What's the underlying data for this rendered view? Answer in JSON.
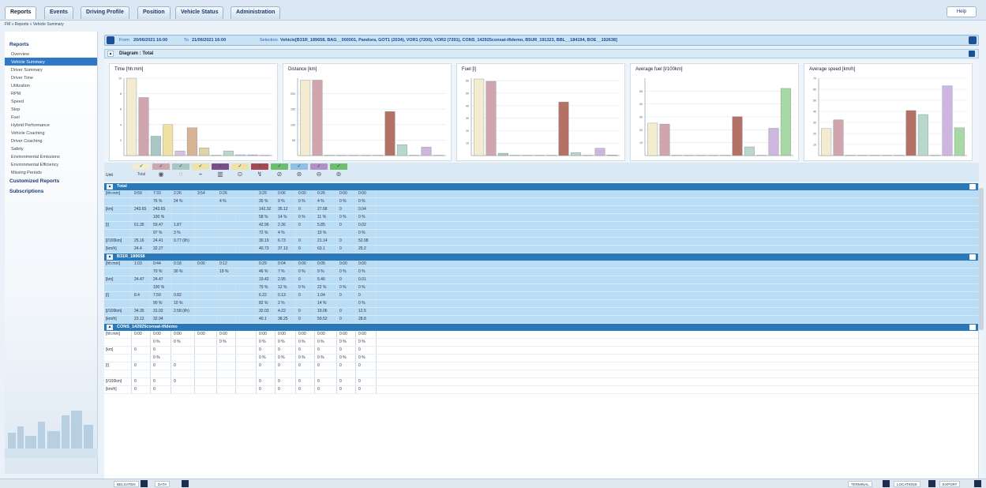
{
  "nav": {
    "tabs": [
      "Reports",
      "Events",
      "Driving Profile",
      "Position",
      "Vehicle Status",
      "Administration"
    ],
    "active_tab": "Reports",
    "help": "Help"
  },
  "breadcrumb": "FM  »  Reports  »  Vehicle Summary",
  "sidebar": {
    "header": "Reports",
    "items": [
      "Overview",
      "Vehicle Summary",
      "Driver Summary",
      "Driver Time",
      "Utilization",
      "RPM",
      "Speed",
      "Stop",
      "Fuel",
      "Hybrid Performance",
      "Vehicle Coaching",
      "Driver Coaching",
      "Safety",
      "Environmental Emissions",
      "Environmental Efficiency",
      "Missing Periods"
    ],
    "selected": "Vehicle Summary",
    "sections": [
      "Customized Reports",
      "Subscriptions"
    ]
  },
  "filter": {
    "from_label": "From",
    "from": "20/06/2021 16:00",
    "to_label": "To",
    "to": "21/06/2021 16:00",
    "selection_label": "Selection",
    "selection": "Vehicle[B31R_189658, BAG__000001, Pandora, GOT1 (2034), VOR1 (7200), VOR2 (7201), CONS_142925consat-tfidemo, B5UR_191323, BBL__184194, BOE__192638]"
  },
  "diagram_title": "Diagram : Total",
  "colors": {
    "bar_series": [
      "#f3ecd0",
      "#cfa6ad",
      "#a9c6c3",
      "#efe2a4",
      "#d7c1dc",
      "#d8b295",
      "#e0d2a9",
      "#b47267",
      "#b7d8cb",
      "#b6d5ed",
      "#cdb7de",
      "#a8d8a5"
    ],
    "section_blue": "#2a78b8",
    "selected": "#2e78c8"
  },
  "chart_data": [
    {
      "type": "bar",
      "title": "Time [hh:mm]",
      "ylim": [
        0,
        10
      ],
      "yticks": [
        "2",
        "4",
        "6",
        "8",
        "10"
      ],
      "values": [
        10,
        7.5,
        2.5,
        4,
        0.6,
        3.6,
        1,
        0,
        0.6,
        0.1,
        0.1,
        0
      ]
    },
    {
      "type": "bar",
      "title": "Distance [km]",
      "ylim": [
        0,
        250
      ],
      "yticks": [
        "50",
        "100",
        "150",
        "200"
      ],
      "values": [
        243.65,
        243.65,
        0,
        0,
        0,
        0,
        0,
        142.32,
        35.12,
        0,
        27.68,
        0
      ]
    },
    {
      "type": "bar",
      "title": "Fuel [l]",
      "ylim": [
        0,
        62
      ],
      "yticks": [
        "10",
        "20",
        "30",
        "40",
        "50",
        "60"
      ],
      "values": [
        61.35,
        59.47,
        1.87,
        0,
        0,
        0,
        0,
        42.96,
        2.36,
        0,
        5.85,
        0.02
      ]
    },
    {
      "type": "bar",
      "title": "Average fuel [l/100km]",
      "ylim": [
        0,
        60
      ],
      "yticks": [
        "10",
        "20",
        "30",
        "40",
        "50"
      ],
      "values": [
        25.16,
        24.41,
        0,
        0,
        0,
        0,
        0,
        30.19,
        6.73,
        0,
        21.14,
        52.08
      ]
    },
    {
      "type": "bar",
      "title": "Average speed [km/h]",
      "ylim": [
        0,
        70
      ],
      "yticks": [
        "10",
        "20",
        "30",
        "40",
        "50",
        "60",
        "70"
      ],
      "values": [
        24.4,
        32.27,
        0,
        0,
        0,
        0,
        0,
        40.73,
        37.13,
        0,
        63.1,
        25.2
      ]
    }
  ],
  "icon_row": {
    "unit": "Unit",
    "total": "Total",
    "checks": [
      "✓",
      "✓",
      "✓",
      "✓",
      "✓",
      "✓",
      "✓",
      "✓",
      "✓",
      "✓",
      "✓",
      "✓"
    ],
    "icons": [
      "fuel-wheel-icon",
      "engine-icon",
      "idle-icon",
      "pto-icon",
      "coasting-icon",
      "brake-icon",
      "gauge-icon",
      "overspeed-icon",
      "stop-icon",
      "cruise-icon"
    ]
  },
  "sections": [
    {
      "title": "Total",
      "blue": true,
      "rows": [
        [
          "[hh:mm]",
          "9:59",
          "7:33",
          "2:26",
          "3:54",
          "0:26",
          "3:29",
          "0:06",
          "0:00",
          "0:26",
          "0:00",
          "0:00"
        ],
        [
          "",
          "",
          "76 %",
          "24 %",
          "",
          "4 %",
          "35 %",
          "9 %",
          "0 %",
          "4 %",
          "0 %",
          "0 %"
        ],
        [
          "[km]",
          "243.65",
          "243.65",
          "",
          "",
          "",
          "142.32",
          "35.12",
          "0",
          "27.68",
          "0",
          "0.04"
        ],
        [
          "",
          "",
          "100 %",
          "",
          "",
          "",
          "58 %",
          "14 %",
          "0 %",
          "11 %",
          "0 %",
          "0 %"
        ],
        [
          "[l]",
          "61.35",
          "59.47",
          "1.87",
          "",
          "",
          "42.96",
          "2.36",
          "0",
          "5.85",
          "0",
          "0.02"
        ],
        [
          "",
          "",
          "97 %",
          "3 %",
          "",
          "",
          "72 %",
          "4 %",
          "",
          "10 %",
          "",
          "0 %"
        ],
        [
          "[l/100km]",
          "25.16",
          "24.41",
          "0.77 (l/h)",
          "",
          "",
          "30.19",
          "6.73",
          "0",
          "21.14",
          "0",
          "52.08"
        ],
        [
          "[km/h]",
          "24.4",
          "32.27",
          "",
          "",
          "",
          "40.73",
          "37.13",
          "0",
          "63.1",
          "0",
          "25.2"
        ]
      ]
    },
    {
      "title": "B31R_189658",
      "blue": true,
      "rows": [
        [
          "[hh:mm]",
          "1:03",
          "0:44",
          "0:18",
          "0:00",
          "0:12",
          "0:29",
          "0:04",
          "0:00",
          "0:05",
          "0:00",
          "0:00"
        ],
        [
          "",
          "",
          "70 %",
          "30 %",
          "",
          "19 %",
          "46 %",
          "7 %",
          "0 %",
          "9 %",
          "0 %",
          "0 %"
        ],
        [
          "[km]",
          "24.47",
          "24.47",
          "",
          "",
          "",
          "19.42",
          "2.95",
          "0",
          "5.46",
          "0",
          "0.01"
        ],
        [
          "",
          "",
          "100 %",
          "",
          "",
          "",
          "79 %",
          "12 %",
          "0 %",
          "22 %",
          "0 %",
          "0 %"
        ],
        [
          "[l]",
          "8.4",
          "7.59",
          "0.82",
          "",
          "",
          "6.22",
          "0.13",
          "0",
          "1.04",
          "0",
          "0"
        ],
        [
          "",
          "",
          "90 %",
          "10 %",
          "",
          "",
          "82 %",
          "2 %",
          "",
          "14 %",
          "",
          "0 %"
        ],
        [
          "[l/100km]",
          "34.35",
          "31.02",
          "2.58 (l/h)",
          "",
          "",
          "32.03",
          "4.22",
          "0",
          "19.06",
          "0",
          "12.5"
        ],
        [
          "[km/h]",
          "23.12",
          "32.94",
          "",
          "",
          "",
          "40.1",
          "38.25",
          "0",
          "59.52",
          "0",
          "28.8"
        ]
      ]
    },
    {
      "title": "CONS_142925consat-tfidemo",
      "blue": false,
      "rows": [
        [
          "[hh:mm]",
          "0:00",
          "0:00",
          "0:00",
          "0:00",
          "0:00",
          "0:00",
          "0:00",
          "0:00",
          "0:00",
          "0:00",
          "0:00"
        ],
        [
          "",
          "",
          "0 %",
          "0 %",
          "",
          "0 %",
          "0 %",
          "0 %",
          "0 %",
          "0 %",
          "0 %",
          "0 %"
        ],
        [
          "[km]",
          "0",
          "0",
          "",
          "",
          "",
          "0",
          "0",
          "0",
          "0",
          "0",
          "0"
        ],
        [
          "",
          "",
          "0 %",
          "",
          "",
          "",
          "0 %",
          "0 %",
          "0 %",
          "0 %",
          "0 %",
          "0 %"
        ],
        [
          "[l]",
          "0",
          "0",
          "0",
          "",
          "",
          "0",
          "0",
          "0",
          "0",
          "0",
          "0"
        ],
        [
          "",
          "",
          "",
          "",
          "",
          "",
          "",
          "",
          "",
          "",
          "",
          ""
        ],
        [
          "[l/100km]",
          "0",
          "0",
          "0",
          "",
          "",
          "0",
          "0",
          "0",
          "0",
          "0",
          "0"
        ],
        [
          "[km/h]",
          "0",
          "0",
          "",
          "",
          "",
          "0",
          "0",
          "0",
          "0",
          "0",
          "0"
        ]
      ]
    }
  ],
  "bottombar": [
    "BELGATEN",
    "DATA",
    "TERMINAL",
    "LOCATIONS",
    "EXPORT"
  ]
}
